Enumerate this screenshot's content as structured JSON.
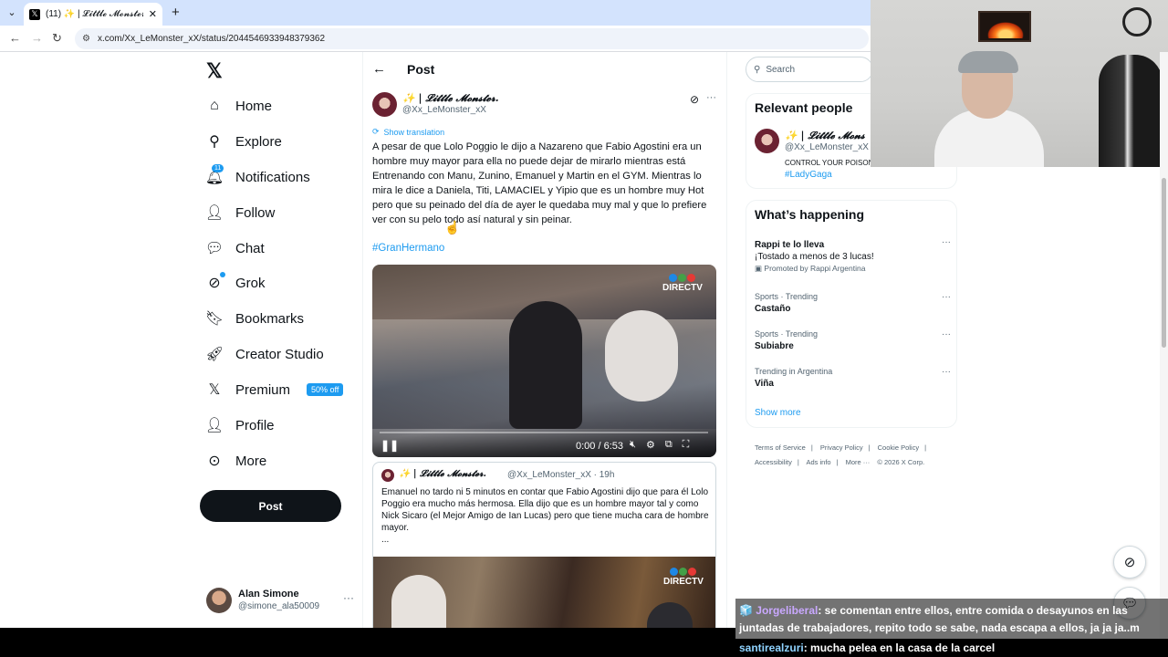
{
  "browser": {
    "tab_title": "(11) ✨ | 𝓛𝓲𝓽𝓽𝓵𝓮 𝓜𝓸𝓷𝓼𝓽𝓮𝓻. o",
    "url": "x.com/Xx_LeMonster_xX/status/2044546933948379362"
  },
  "nav": {
    "items": [
      {
        "label": "Home",
        "icon": "home-icon"
      },
      {
        "label": "Explore",
        "icon": "search-icon"
      },
      {
        "label": "Notifications",
        "icon": "bell-icon",
        "badge": "11"
      },
      {
        "label": "Follow",
        "icon": "person-add-icon"
      },
      {
        "label": "Chat",
        "icon": "chat-icon"
      },
      {
        "label": "Grok",
        "icon": "grok-icon"
      },
      {
        "label": "Bookmarks",
        "icon": "bookmark-icon"
      },
      {
        "label": "Creator Studio",
        "icon": "rocket-icon"
      },
      {
        "label": "Premium",
        "icon": "x-icon",
        "badge": "50% off"
      },
      {
        "label": "Profile",
        "icon": "person-icon"
      },
      {
        "label": "More",
        "icon": "more-circle-icon"
      }
    ],
    "post_label": "Post",
    "account": {
      "name": "Alan Simone",
      "handle": "@simone_ala50009"
    }
  },
  "post": {
    "header_title": "Post",
    "author_name": "✨ | 𝓛𝓲𝓽𝓽𝓵𝓮 𝓜𝓸𝓷𝓼𝓽𝓮𝓻.",
    "author_handle": "@Xx_LeMonster_xX",
    "show_translation": "Show translation",
    "text": "A pesar de que Lolo Poggio le dijo a Nazareno que Fabio Agostini era un hombre muy mayor para ella no puede dejar de mirarlo mientras está Entrenando con Manu, Zunino, Emanuel y Martin en el GYM. Mientras lo mira le dice a Daniela, Titi, LAMACIEL y Yipio que es un hombre muy Hot pero que su peinado del día de ayer le quedaba muy mal y que lo prefiere ver con su pelo todo así natural y sin peinar.",
    "hashtag": "#GranHermano",
    "video": {
      "brand": "DIRECTV",
      "time": "0:00 / 6:53",
      "progress": 0
    },
    "quote": {
      "author_name": "✨ | 𝓛𝓲𝓽𝓽𝓵𝓮 𝓜𝓸𝓷𝓼𝓽𝓮𝓻.",
      "meta": "@Xx_LeMonster_xX · 19h",
      "text": "Emanuel no tardo ni 5 minutos en contar que Fabio Agostini dijo que para él Lolo Poggio era mucho más hermosa. Ella dijo que es un hombre mayor tal y como Nick Sicaro (el Mejor Amigo de Ian Lucas) pero que tiene mucha cara de hombre mayor.",
      "ellipsis": "...",
      "brand": "DIRECTV"
    }
  },
  "sidebar": {
    "search_placeholder": "Search",
    "relevant_title": "Relevant people",
    "relevant": {
      "name": "✨ | 𝓛𝓲𝓽𝓽𝓵𝓮 𝓜𝓸𝓷𝓼",
      "handle": "@Xx_LeMonster_xX",
      "bio": "CONTROL YOUR POISON,",
      "tag": "#LadyGaga"
    },
    "happening_title": "What’s happening",
    "trends": [
      {
        "meta": "",
        "name": "Rappi te lo lleva",
        "sub": "¡Tostado a menos de 3 lucas!",
        "promo": "Promoted by Rappi Argentina"
      },
      {
        "meta": "Sports · Trending",
        "name": "Castaño"
      },
      {
        "meta": "Sports · Trending",
        "name": "Subiabre"
      },
      {
        "meta": "Trending in Argentina",
        "name": "Viña"
      }
    ],
    "show_more": "Show more",
    "footer": [
      "Terms of Service",
      "|",
      "Privacy Policy",
      "|",
      "Cookie Policy",
      "|",
      "Accessibility",
      "|",
      "Ads info",
      "|",
      "More ···",
      "© 2026 X Corp."
    ]
  },
  "chat_overlay": {
    "user1": "Jorgeliberal",
    "msg1": ": se comentan entre ellos, entre comida o desayunos en las juntadas de trabajadores, repito todo se sabe, nada escapa a ellos, ja ja ja..m",
    "user2": "santirealzuri",
    "msg2": ": mucha pelea en la casa de la carcel"
  },
  "colors": {
    "accent": "#1d9bf0",
    "text": "#0f1419",
    "muted": "#536471"
  }
}
